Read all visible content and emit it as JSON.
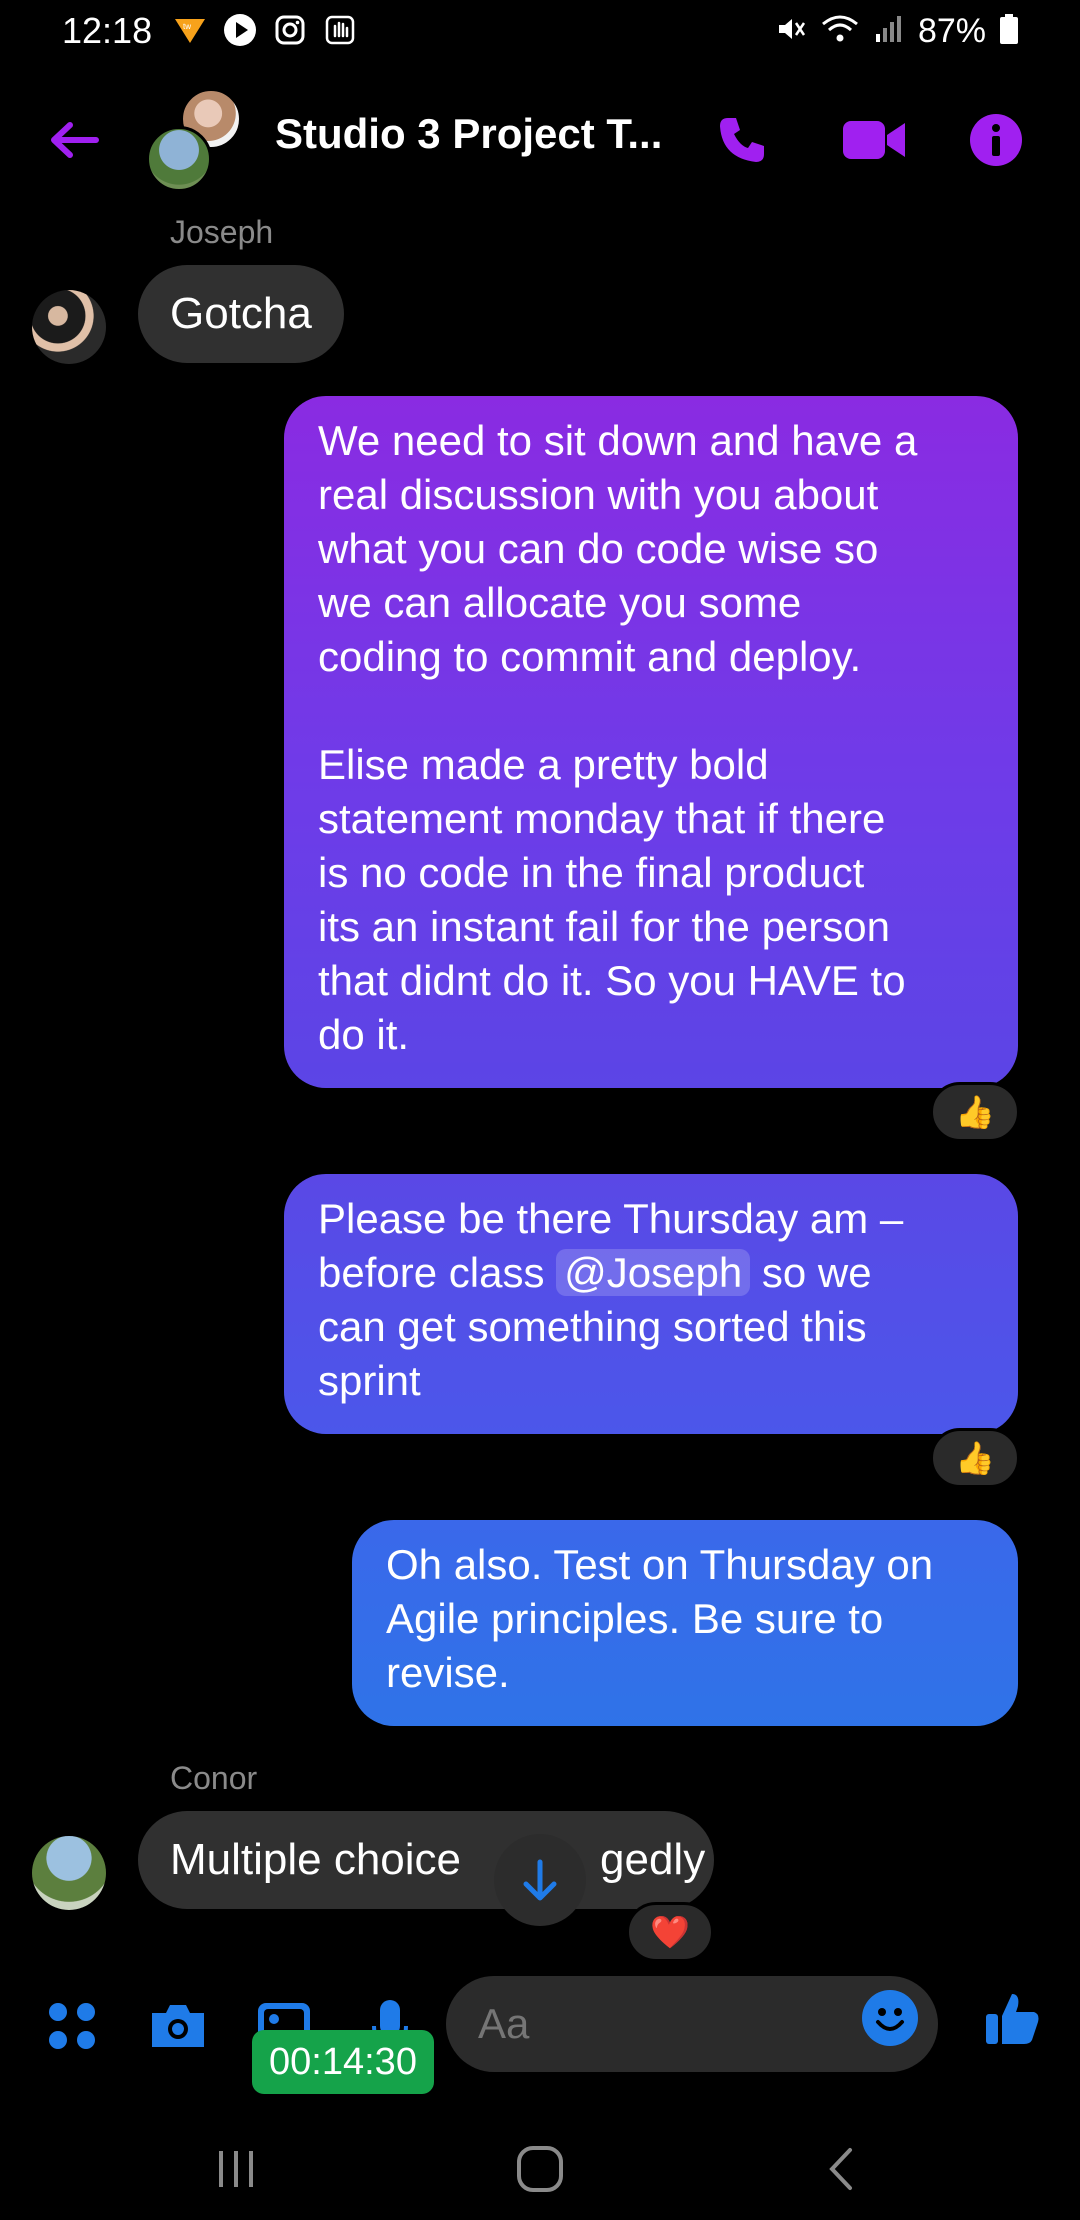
{
  "status_bar": {
    "time": "12:18",
    "battery_pct": "87%",
    "icons": [
      "app-notification-icon",
      "play-icon",
      "instagram-icon",
      "hand-icon",
      "mute-icon",
      "wifi-icon",
      "signal-icon",
      "battery-icon"
    ]
  },
  "header": {
    "title": "Studio 3 Project T...",
    "icons": [
      "back-arrow-icon",
      "phone-icon",
      "video-icon",
      "info-icon"
    ],
    "accent": "#a020f0"
  },
  "messages": [
    {
      "sender": "Joseph",
      "text": "Gotcha",
      "direction": "incoming"
    },
    {
      "direction": "outgoing",
      "text": "We need to sit down and have a\nreal discussion with you about\nwhat you can do code wise so\nwe can allocate you some\ncoding to commit and deploy.\n\nElise made a pretty bold\nstatement monday that if there\nis no code in the final product\nits an instant fail for the person\nthat didnt do it. So you HAVE to\ndo it.",
      "reaction": "👍"
    },
    {
      "direction": "outgoing",
      "text_before": "Please be there  Thursday am –\nbefore class ",
      "mention": "@Joseph",
      "text_after": " so we\ncan get something sorted this\nsprint",
      "reaction": "👍"
    },
    {
      "direction": "outgoing",
      "text": "Oh also. Test on Thursday on\nAgile principles. Be sure to\nrevise."
    },
    {
      "sender": "Conor",
      "text": "Multiple choice allegedly",
      "visible_text_left": "Multiple choice",
      "visible_text_right": "gedly",
      "direction": "incoming",
      "reaction": "❤️"
    }
  ],
  "composer": {
    "placeholder": "Aa",
    "timer": "00:14:30",
    "icons": [
      "menu-grid-icon",
      "camera-icon",
      "gallery-icon",
      "mic-icon",
      "emoji-icon",
      "thumbs-up-icon"
    ],
    "accent": "#1f7be8"
  },
  "nav_bar": {
    "icons": [
      "recent-apps-icon",
      "home-icon",
      "back-icon"
    ]
  }
}
